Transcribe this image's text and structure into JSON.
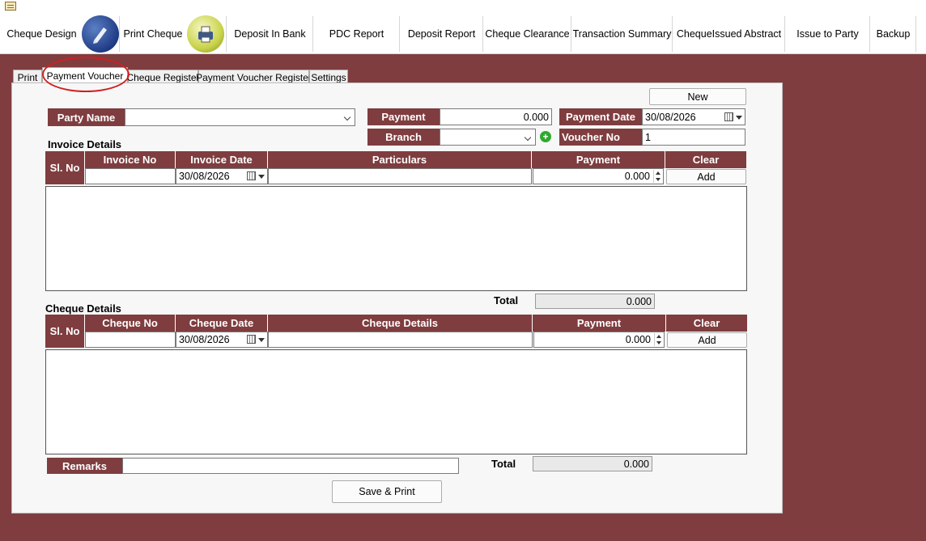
{
  "toolbar": {
    "cheque_design": "Cheque Design",
    "print_cheque": "Print Cheque",
    "deposit_in_bank": "Deposit In Bank",
    "pdc_report": "PDC Report",
    "deposit_report": "Deposit Report",
    "cheque_clearance": "Cheque Clearance",
    "transaction_summary": "Transaction Summary",
    "cheque_issued_abstract": "ChequeIssued Abstract",
    "issue_to_party": "Issue to Party",
    "backup": "Backup"
  },
  "tabs": {
    "print": "Print",
    "payment_voucher": "Payment Voucher",
    "cheque_register": "Cheque Register",
    "payment_voucher_register": "Payment Voucher Register",
    "settings": "Settings"
  },
  "form": {
    "new_button": "New",
    "party_name_label": "Party Name",
    "party_name_value": "",
    "payment_label": "Payment",
    "payment_value": "0.000",
    "payment_date_label": "Payment Date",
    "payment_date_value": "30/08/2026",
    "branch_label": "Branch",
    "branch_value": "",
    "voucher_no_label": "Voucher No",
    "voucher_no_value": "1",
    "remarks_label": "Remarks",
    "remarks_value": "",
    "save_print_button": "Save & Print"
  },
  "invoice": {
    "title": "Invoice Details",
    "columns": [
      "Sl. No",
      "Invoice No",
      "Invoice Date",
      "Particulars",
      "Payment",
      "Clear"
    ],
    "entry_date": "30/08/2026",
    "entry_payment": "0.000",
    "add_button": "Add",
    "total_label": "Total",
    "total_value": "0.000"
  },
  "cheque": {
    "title": "Cheque Details",
    "columns": [
      "Sl. No",
      "Cheque No",
      "Cheque Date",
      "Cheque Details",
      "Payment",
      "Clear"
    ],
    "entry_date": "30/08/2026",
    "entry_payment": "0.000",
    "add_button": "Add",
    "total_label": "Total",
    "total_value": "0.000"
  },
  "colors": {
    "accent": "#7f3d3f",
    "annotation": "#d02020"
  }
}
